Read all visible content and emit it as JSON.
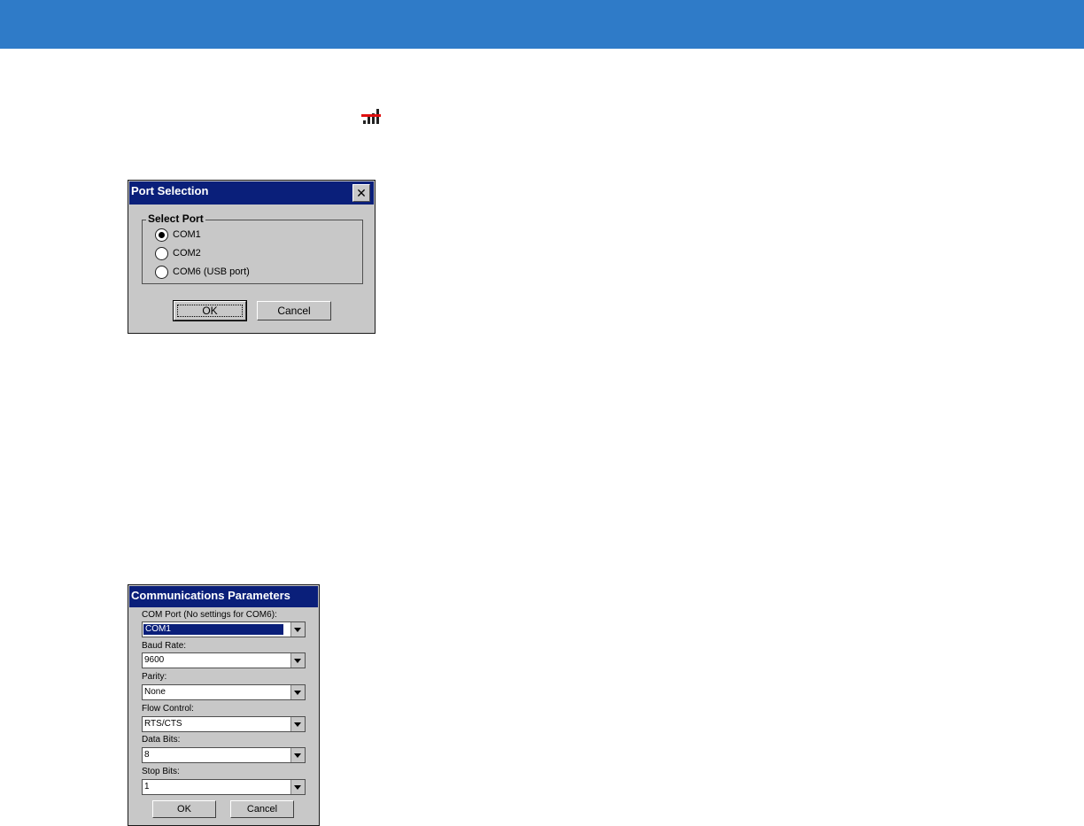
{
  "port_dialog": {
    "title": "Port Selection",
    "close_label": "✕",
    "group_label": "Select Port",
    "options": [
      {
        "label": "COM1",
        "checked": true
      },
      {
        "label": "COM2",
        "checked": false
      },
      {
        "label": "COM6 (USB port)",
        "checked": false
      }
    ],
    "ok_label": "OK",
    "cancel_label": "Cancel"
  },
  "comm_dialog": {
    "title": "Communications Parameters",
    "fields": [
      {
        "label": "COM Port (No settings for COM6):",
        "value": "COM1"
      },
      {
        "label": "Baud Rate:",
        "value": "9600"
      },
      {
        "label": "Parity:",
        "value": "None"
      },
      {
        "label": "Flow Control:",
        "value": "RTS/CTS"
      },
      {
        "label": "Data Bits:",
        "value": "8"
      },
      {
        "label": "Stop Bits:",
        "value": "1"
      }
    ],
    "ok_label": "OK",
    "cancel_label": "Cancel"
  },
  "icons": {
    "signal": "signal-strength-icon"
  },
  "colors": {
    "header_bar": "#2f7bc8",
    "titlebar": "#0a1f7a",
    "dialog_bg": "#c8c8c8",
    "signal_red": "#e01010"
  }
}
